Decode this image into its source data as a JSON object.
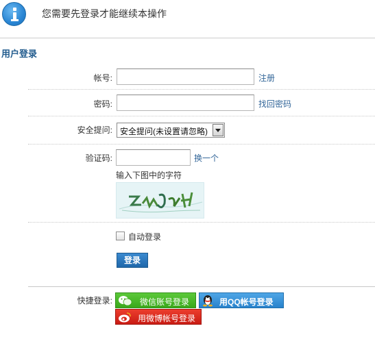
{
  "notice": {
    "icon": "info-icon",
    "text": "您需要先登录才能继续本操作"
  },
  "section": {
    "title": "用户登录"
  },
  "form": {
    "account": {
      "label": "帐号:",
      "value": "",
      "link": "注册"
    },
    "password": {
      "label": "密码:",
      "value": "",
      "link": "找回密码"
    },
    "question": {
      "label": "安全提问:",
      "selected": "安全提问(未设置请忽略)"
    },
    "captcha": {
      "label": "验证码:",
      "value": "",
      "link": "换一个",
      "hint": "输入下图中的字符"
    },
    "remember": {
      "label": "自动登录",
      "checked": false
    },
    "submit_label": "登录"
  },
  "quick_login": {
    "label": "快捷登录:",
    "wechat": "微信账号登录",
    "qq": "用QQ帐号登录",
    "weibo": "用微博帐号登录"
  },
  "colors": {
    "link": "#336699",
    "section_title": "#225c8e",
    "wechat": "#3fae22",
    "qq": "#2f8bd6",
    "weibo": "#d9261c",
    "submit": "#1f67aa"
  }
}
